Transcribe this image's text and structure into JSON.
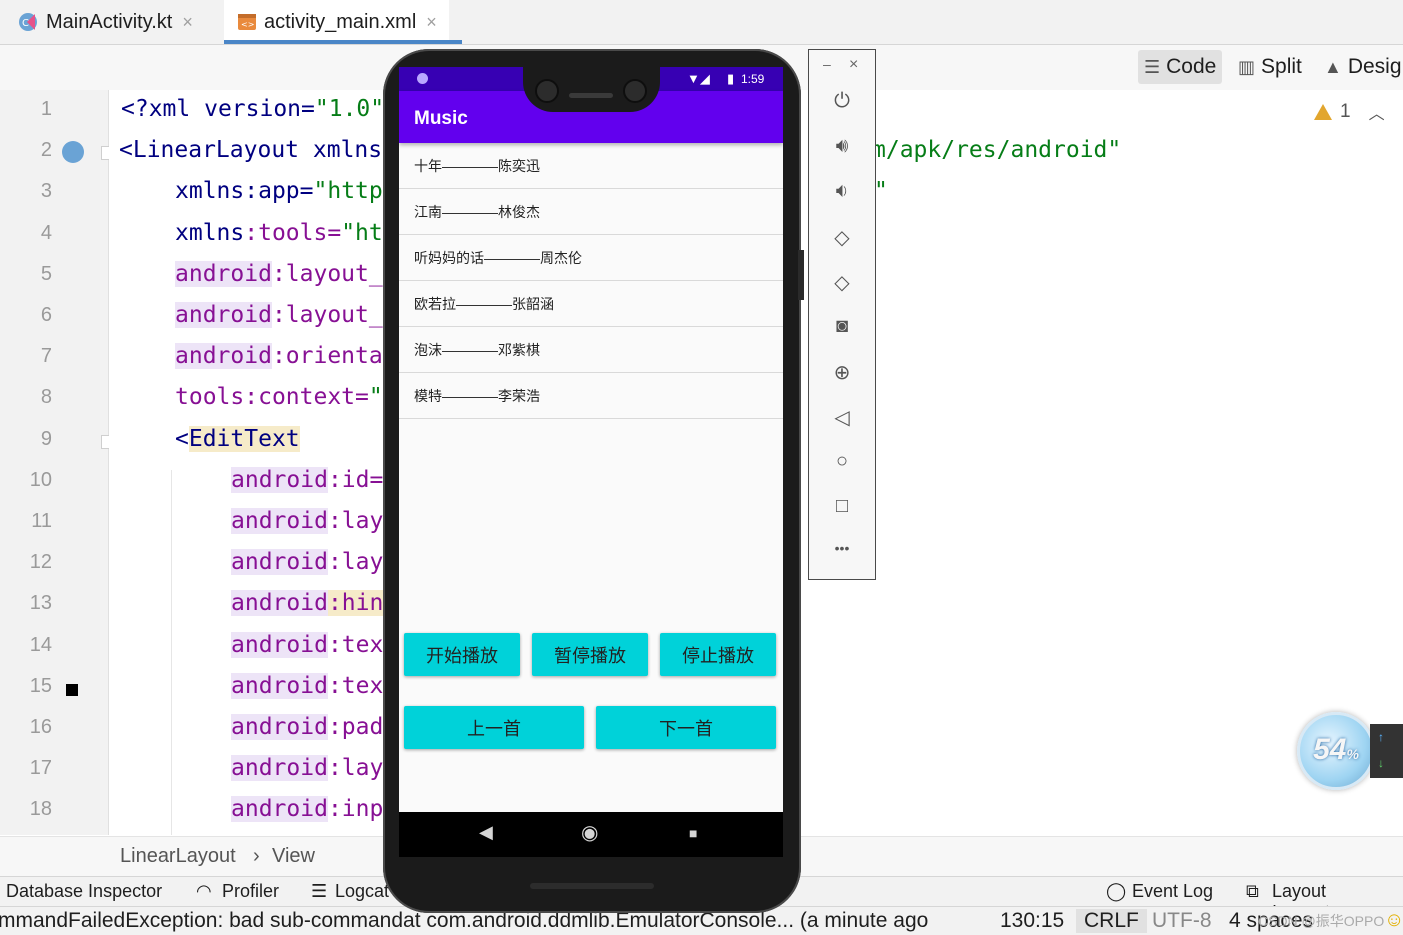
{
  "tabs": [
    {
      "label": "MainActivity.kt",
      "icon": "kotlin-file-icon",
      "close": "×"
    },
    {
      "label": "activity_main.xml",
      "icon": "xml-layout-icon",
      "close": "×"
    }
  ],
  "editor_modes": {
    "code": "Code",
    "split": "Split",
    "design": "Desig"
  },
  "warnings": {
    "count": "1"
  },
  "line_numbers": [
    "1",
    "2",
    "3",
    "4",
    "5",
    "6",
    "7",
    "8",
    "9",
    "10",
    "11",
    "12",
    "13",
    "14",
    "15",
    "16",
    "17",
    "18"
  ],
  "code_lines": [
    {
      "a": "<?",
      "b": "xml version=",
      "c": "\"1.0\""
    },
    {
      "a": "<LinearLayout ",
      "b": "xmlns",
      "c": ""
    },
    {
      "a": "xmlns",
      "b": ":app=",
      "c": "\"http"
    },
    {
      "a": "xmlns",
      "b": ":tools=",
      "c": "\"ht"
    },
    {
      "a": "android",
      "b": ":layout_",
      "c": ""
    },
    {
      "a": "android",
      "b": ":layout_",
      "c": ""
    },
    {
      "a": "android",
      "b": ":orienta",
      "c": ""
    },
    {
      "a": "tools",
      "b": ":context=",
      "c": "\""
    },
    {
      "a": "<",
      "b": "EditText",
      "c": ""
    },
    {
      "a": "android",
      "b": ":id=",
      "c": ""
    },
    {
      "a": "android",
      "b": ":lay",
      "c": ""
    },
    {
      "a": "android",
      "b": ":lay",
      "c": ""
    },
    {
      "a": "android",
      "b": ":hin",
      "c": ""
    },
    {
      "a": "android",
      "b": ":tex",
      "c": ""
    },
    {
      "a": "android",
      "b": ":tex",
      "c": ""
    },
    {
      "a": "android",
      "b": ":pad",
      "c": ""
    },
    {
      "a": "android",
      "b": ":lay",
      "c": ""
    },
    {
      "a": "android",
      "b": ":inp",
      "c": ""
    }
  ],
  "code_right": {
    "line2": "m/apk/res/android\"",
    "line3": "\""
  },
  "breadcrumb": {
    "first": "LinearLayout",
    "sep": "›",
    "second": "View"
  },
  "tool_windows": {
    "database_inspector": "Database Inspector",
    "profiler": "Profiler",
    "logcat": "Logcat",
    "event_log": "Event Log",
    "layout_inspector": "Layout Inspector"
  },
  "status_bar": {
    "message": "mmandFailedException: bad sub-commandat com.android.ddmlib.EmulatorConsole... (a minute ago",
    "position": "130:15",
    "line_sep": "CRLF",
    "encoding": "UTF-8",
    "indent": "4 spaces",
    "watermark": "CSDN @振华OPPO"
  },
  "emulator": {
    "time": "1:59",
    "app_title": "Music",
    "songs": [
      "十年————陈奕迅",
      "江南————林俊杰",
      "听妈妈的话————周杰伦",
      "欧若拉————张韶涵",
      "泡沫————邓紫棋",
      "模特————李荣浩"
    ],
    "buttons": {
      "play": "开始播放",
      "pause": "暂停播放",
      "stop": "停止播放",
      "prev": "上一首",
      "next": "下一首"
    },
    "nav": {
      "back": "◀",
      "home": "◉",
      "recents": "■"
    },
    "colors": {
      "status_bar": "#3700b3",
      "app_bar": "#6200ee",
      "button": "#00d2d9"
    }
  },
  "side_panel": {
    "minimize": "–",
    "close": "×",
    "more": "•••"
  },
  "widget": {
    "percent": "54",
    "unit": "%"
  }
}
